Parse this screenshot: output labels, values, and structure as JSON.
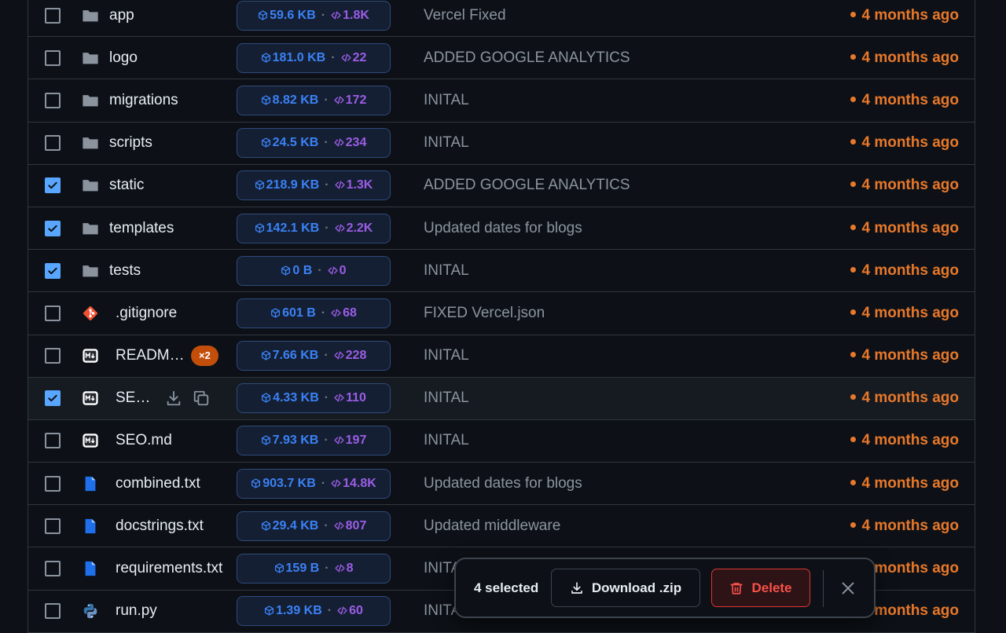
{
  "colors": {
    "background": "#0d1117",
    "checkbox_checked": "#58a6ff",
    "size_text": "#3b82f6",
    "lines_text": "#9b5de5",
    "time_text": "#e8782a",
    "delete_text": "#f85149",
    "readme_badge": "#c24e0a"
  },
  "files": [
    {
      "name": "app",
      "type": "folder",
      "icon": "folder-icon",
      "checked": false,
      "size": "59.6 KB",
      "lines": "1.8K",
      "message": "Vercel Fixed",
      "time": "4 months ago"
    },
    {
      "name": "logo",
      "type": "folder",
      "icon": "folder-icon",
      "checked": false,
      "size": "181.0 KB",
      "lines": "22",
      "message": "ADDED GOOGLE ANALYTICS",
      "time": "4 months ago"
    },
    {
      "name": "migrations",
      "type": "folder",
      "icon": "folder-icon",
      "checked": false,
      "size": "8.82 KB",
      "lines": "172",
      "message": "INITAL",
      "time": "4 months ago"
    },
    {
      "name": "scripts",
      "type": "folder",
      "icon": "folder-icon",
      "checked": false,
      "size": "24.5 KB",
      "lines": "234",
      "message": "INITAL",
      "time": "4 months ago"
    },
    {
      "name": "static",
      "type": "folder",
      "icon": "folder-icon",
      "checked": true,
      "size": "218.9 KB",
      "lines": "1.3K",
      "message": "ADDED GOOGLE ANALYTICS",
      "time": "4 months ago"
    },
    {
      "name": "templates",
      "type": "folder",
      "icon": "folder-icon",
      "checked": true,
      "size": "142.1 KB",
      "lines": "2.2K",
      "message": "Updated dates for blogs",
      "time": "4 months ago"
    },
    {
      "name": "tests",
      "type": "folder",
      "icon": "folder-icon",
      "checked": true,
      "size": "0 B",
      "lines": "0",
      "message": "INITAL",
      "time": "4 months ago"
    },
    {
      "name": ".gitignore",
      "type": "file",
      "icon": "git-icon",
      "checked": false,
      "size": "601 B",
      "lines": "68",
      "message": "FIXED Vercel.json",
      "time": "4 months ago"
    },
    {
      "name": "READM…",
      "type": "file",
      "icon": "markdown-icon",
      "checked": false,
      "badge": "×2",
      "size": "7.66 KB",
      "lines": "228",
      "message": "INITAL",
      "time": "4 months ago"
    },
    {
      "name": "SE…",
      "type": "file",
      "icon": "markdown-icon",
      "checked": true,
      "hovered": true,
      "size": "4.33 KB",
      "lines": "110",
      "message": "INITAL",
      "time": "4 months ago"
    },
    {
      "name": "SEO.md",
      "type": "file",
      "icon": "markdown-icon",
      "checked": false,
      "size": "7.93 KB",
      "lines": "197",
      "message": "INITAL",
      "time": "4 months ago"
    },
    {
      "name": "combined.txt",
      "type": "file",
      "icon": "text-file-icon",
      "checked": false,
      "size": "903.7 KB",
      "lines": "14.8K",
      "message": "Updated dates for blogs",
      "time": "4 months ago"
    },
    {
      "name": "docstrings.txt",
      "type": "file",
      "icon": "text-file-icon",
      "checked": false,
      "size": "29.4 KB",
      "lines": "807",
      "message": "Updated middleware",
      "time": "4 months ago"
    },
    {
      "name": "requirements.txt",
      "type": "file",
      "icon": "text-file-icon",
      "checked": false,
      "size": "159 B",
      "lines": "8",
      "message": "INITAL",
      "time": "4 months ago"
    },
    {
      "name": "run.py",
      "type": "file",
      "icon": "python-icon",
      "checked": false,
      "size": "1.39 KB",
      "lines": "60",
      "message": "INITAL",
      "time": "4 months ago"
    }
  ],
  "selection_bar": {
    "count_label": "4 selected",
    "download_label": "Download .zip",
    "delete_label": "Delete"
  }
}
